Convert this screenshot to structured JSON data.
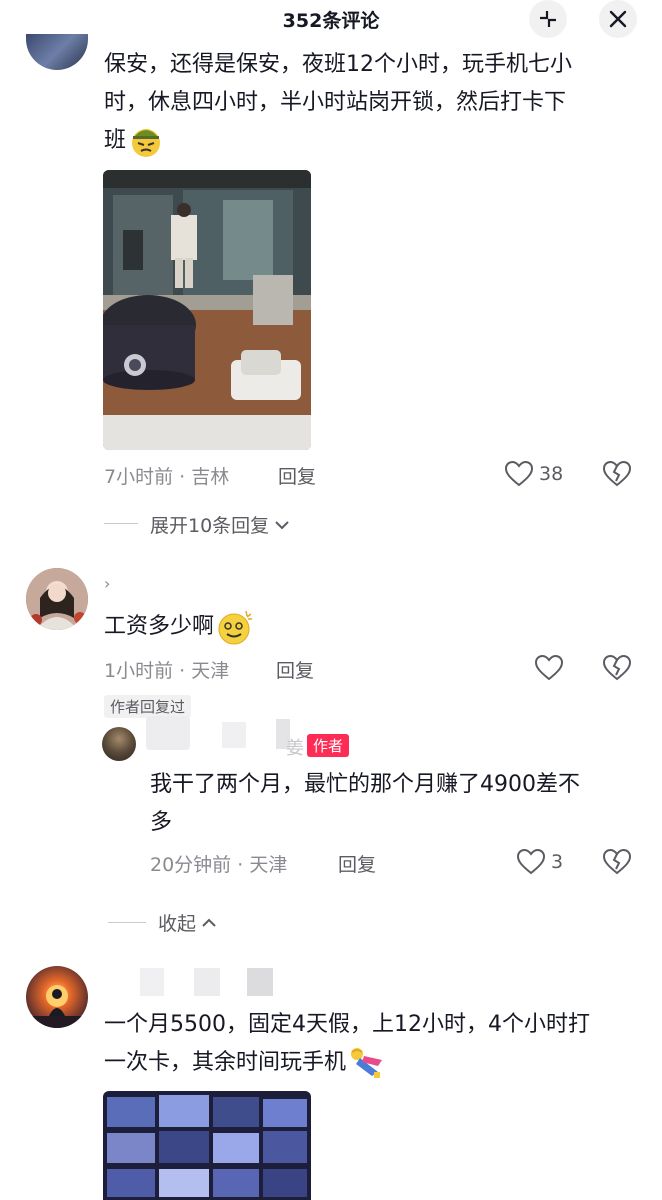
{
  "header": {
    "title": "352条评论"
  },
  "comment1": {
    "text_line1": "保安，还得是保安，夜班12个小时，玩手机七小",
    "text_line2": "时，休息四小时，半小时站岗开锁，然后打卡下",
    "text_line3": "班",
    "time": "7小时前",
    "location": "吉林",
    "reply_label": "回复",
    "likes": "38",
    "expand_label": "展开10条回复"
  },
  "comment2": {
    "text": "工资多少啊",
    "time": "1小时前",
    "location": "天津",
    "reply_label": "回复",
    "author_replied_badge": "作者回复过",
    "reply": {
      "name_fragment": "姜",
      "author_badge": "作者",
      "text_line1": "我干了两个月，最忙的那个月赚了4900差不",
      "text_line2": "多",
      "time": "20分钟前",
      "location": "天津",
      "reply_label": "回复",
      "likes": "3"
    },
    "collapse_label": "收起"
  },
  "comment3": {
    "text_line1": "一个月5500，固定4天假，上12小时，4个小时打",
    "text_line2": "一次卡，其余时间玩手机"
  },
  "colors": {
    "accent": "#fe2c55",
    "meta": "#8a8b91"
  }
}
